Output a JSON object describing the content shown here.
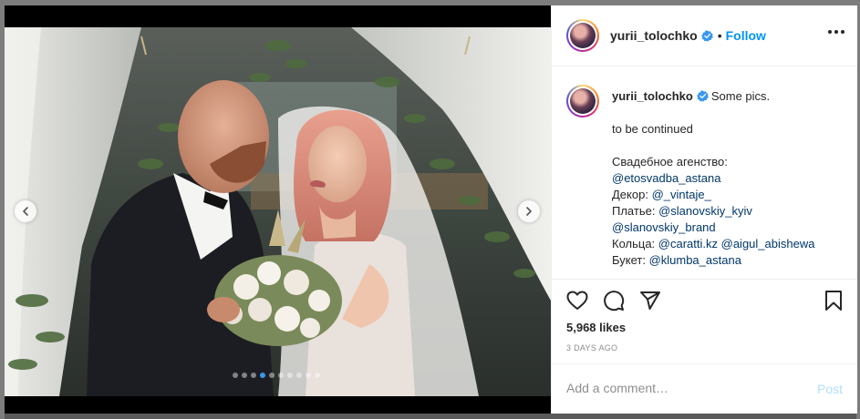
{
  "post": {
    "username": "yurii_tolochko",
    "separator": "•",
    "follow_label": "Follow",
    "more_icon": "more-options-icon",
    "verified_icon": "verified-badge-icon"
  },
  "caption": {
    "username": "yurii_tolochko",
    "first_line": "Some pics.",
    "line2": "to be continued",
    "agency_label": "Свадебное агенство:",
    "agency_mention": "@etosvadba_astana",
    "decor_label": "Декор: ",
    "decor_mention": "@_vintaje_",
    "dress_label": "Платье: ",
    "dress_mention": "@slanovskiy_kyiv",
    "dress_mention2": "@slanovskiy_brand",
    "rings_label": "Кольца: ",
    "rings_mention": "@caratti.kz",
    "rings_mention2": "@aigul_abishewa",
    "bouquet_label": "Букет: ",
    "bouquet_mention": "@klumba_astana"
  },
  "actions": {
    "like_icon": "heart-icon",
    "comment_icon": "comment-icon",
    "share_icon": "share-icon",
    "save_icon": "bookmark-icon"
  },
  "likes": "5,968 likes",
  "date": "3 DAYS AGO",
  "comment": {
    "placeholder": "Add a comment…",
    "post_label": "Post"
  },
  "carousel": {
    "total": 10,
    "active_index": 3
  },
  "colors": {
    "link": "#0095f6",
    "mention": "#00376b",
    "post_disabled": "#b2dffc",
    "active_dot": "#3897f0"
  }
}
